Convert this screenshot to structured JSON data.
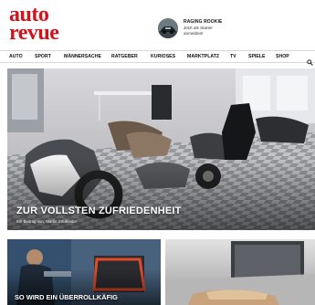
{
  "brand": {
    "logo_line1": "auto",
    "logo_line2": "revue",
    "logo_color": "#d3121a"
  },
  "promo": {
    "title": "RAGING ROOKIE",
    "subtitle": "Jetzt als Starter anmelden!",
    "icon": "car-avatar"
  },
  "nav": {
    "items": [
      "AUTO",
      "SPORT",
      "MÄNNERSACHE",
      "RATGEBER",
      "KURIOSES",
      "MARKTPLATZ",
      "TV",
      "SPIELE",
      "SHOP"
    ],
    "search_icon": "search-icon"
  },
  "hero": {
    "title": "ZUR VOLLSTEN ZUFRIEDENHEIT",
    "byline": "Ein Beitrag von: Martin Strubreiter"
  },
  "cards": [
    {
      "title": "SO WIRD EIN ÜBERROLLKÄFIG"
    },
    {
      "title": ""
    }
  ]
}
